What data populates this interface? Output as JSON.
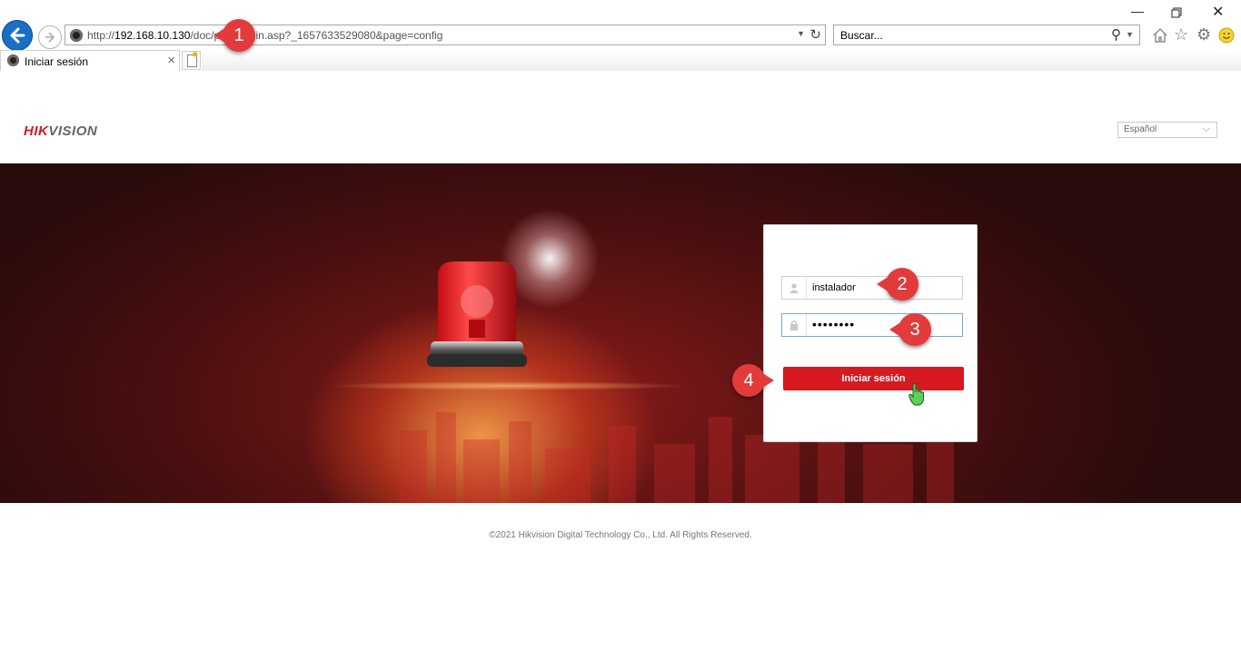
{
  "browser": {
    "url_prefix": "http://",
    "url_host": "192.168.10.130",
    "url_path": "/doc/page/login.asp?_1657633529080&page=config",
    "search_placeholder": "Buscar...",
    "tab_title": "Iniciar sesión",
    "toolbar_icons": [
      "home-icon",
      "favorites-star-icon",
      "settings-gear-icon",
      "feedback-smiley-icon"
    ]
  },
  "page": {
    "logo_brand_hik": "HIK",
    "logo_brand_vision": "VISION",
    "language": "Español"
  },
  "login": {
    "username": "instalador",
    "password_mask": "••••••••",
    "submit_label": "Iniciar sesión"
  },
  "callouts": [
    "1",
    "2",
    "3",
    "4"
  ],
  "footer": "©2021 Hikvision Digital Technology Co., Ltd. All Rights Reserved.",
  "colors": {
    "brand_red": "#d71920",
    "callout_red": "#e33b3b",
    "browser_back_blue": "#1a6fc4"
  }
}
